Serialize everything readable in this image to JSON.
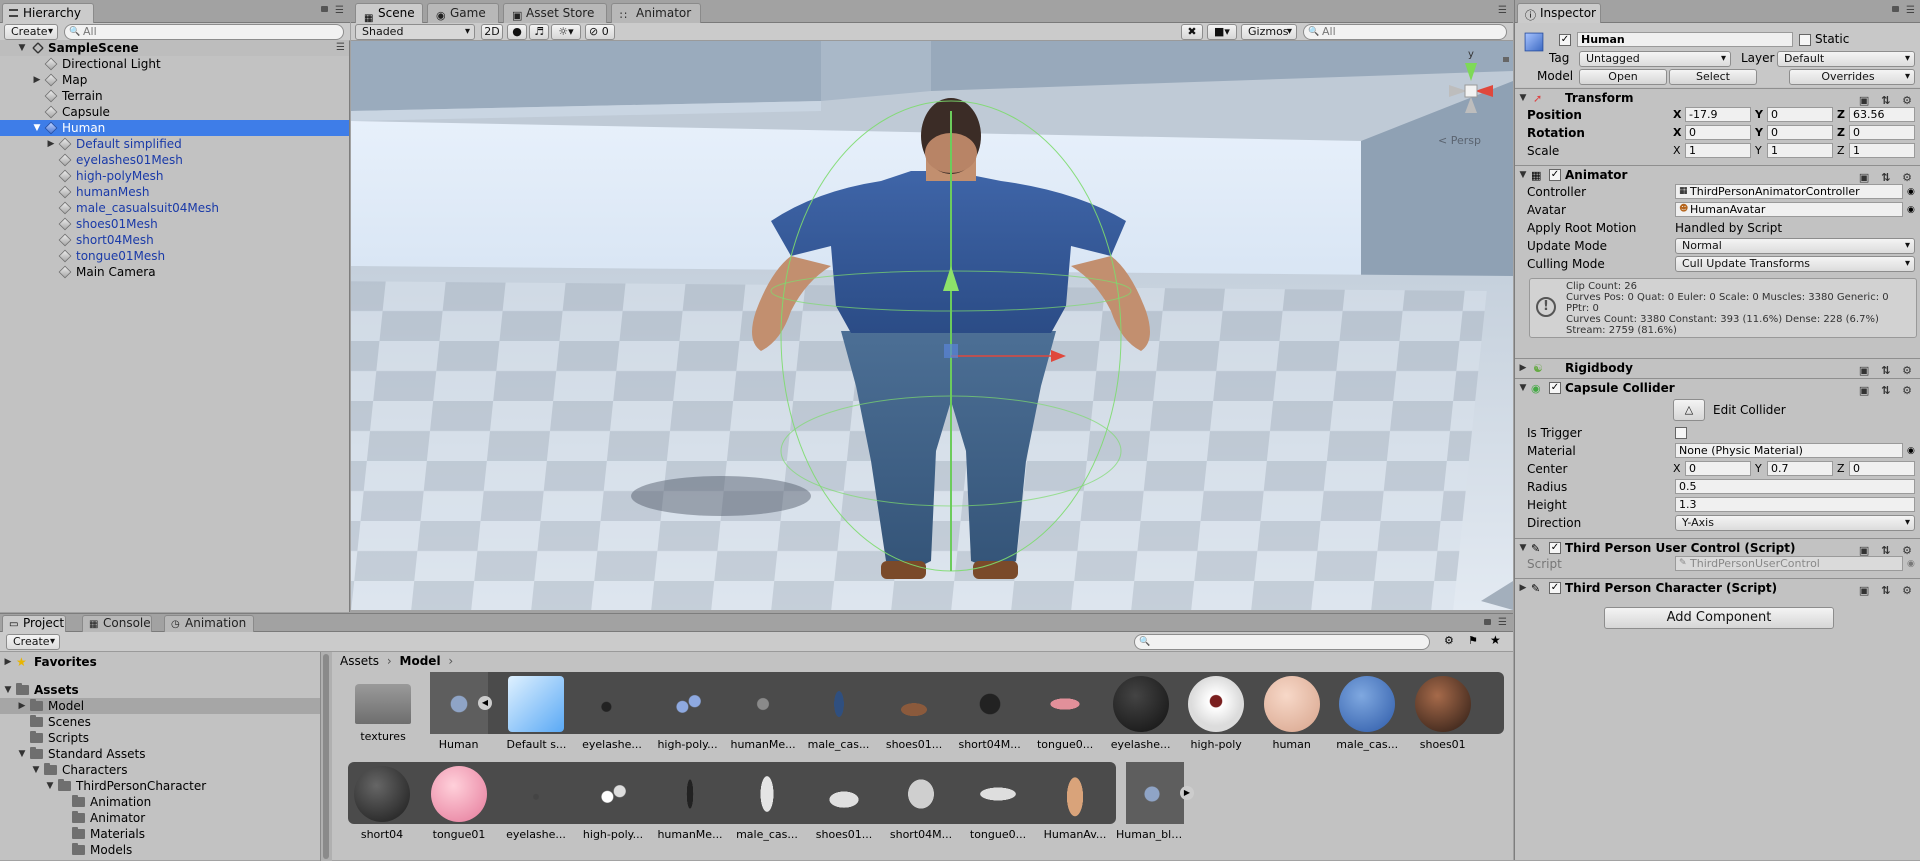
{
  "hierarchy": {
    "tab": "Hierarchy",
    "create": "Create",
    "search_placeholder": "All",
    "scene": "SampleScene",
    "items": [
      {
        "label": "Directional Light"
      },
      {
        "label": "Map"
      },
      {
        "label": "Terrain"
      },
      {
        "label": "Capsule"
      },
      {
        "label": "Human"
      },
      {
        "label": "Default simplified"
      },
      {
        "label": "eyelashes01Mesh"
      },
      {
        "label": "high-polyMesh"
      },
      {
        "label": "humanMesh"
      },
      {
        "label": "male_casualsuit04Mesh"
      },
      {
        "label": "shoes01Mesh"
      },
      {
        "label": "short04Mesh"
      },
      {
        "label": "tongue01Mesh"
      },
      {
        "label": "Main Camera"
      }
    ]
  },
  "scene_view": {
    "tabs": [
      "Scene",
      "Game",
      "Asset Store",
      "Animator"
    ],
    "shading": "Shaded",
    "mode_2d": "2D",
    "fx_count": "0",
    "gizmos": "Gizmos",
    "search_placeholder": "All",
    "persp": "< Persp",
    "gizmo_axes": {
      "y": "y"
    }
  },
  "inspector": {
    "tab": "Inspector",
    "object_name": "Human",
    "static_label": "Static",
    "tag_label": "Tag",
    "tag_value": "Untagged",
    "layer_label": "Layer",
    "layer_value": "Default",
    "model_label": "Model",
    "model_open": "Open",
    "model_select": "Select",
    "model_overrides": "Overrides",
    "transform": {
      "title": "Transform",
      "position_label": "Position",
      "rotation_label": "Rotation",
      "scale_label": "Scale",
      "position": {
        "x": "-17.9",
        "y": "0",
        "z": "63.56"
      },
      "rotation": {
        "x": "0",
        "y": "0",
        "z": "0"
      },
      "scale": {
        "x": "1",
        "y": "1",
        "z": "1"
      }
    },
    "animator": {
      "title": "Animator",
      "controller_label": "Controller",
      "controller_value": "ThirdPersonAnimatorController",
      "avatar_label": "Avatar",
      "avatar_value": "HumanAvatar",
      "root_motion_label": "Apply Root Motion",
      "root_motion_value": "Handled by Script",
      "update_mode_label": "Update Mode",
      "update_mode_value": "Normal",
      "culling_label": "Culling Mode",
      "culling_value": "Cull Update Transforms",
      "info_lines": [
        "Clip Count: 26",
        "Curves Pos: 0 Quat: 0 Euler: 0 Scale: 0 Muscles: 3380 Generic: 0",
        "PPtr: 0",
        "Curves Count: 3380 Constant: 393 (11.6%) Dense: 228 (6.7%)",
        "Stream: 2759 (81.6%)"
      ]
    },
    "rigidbody": {
      "title": "Rigidbody"
    },
    "capsule": {
      "title": "Capsule Collider",
      "edit_collider": "Edit Collider",
      "trigger_label": "Is Trigger",
      "material_label": "Material",
      "material_value": "None (Physic Material)",
      "center_label": "Center",
      "center": {
        "x": "0",
        "y": "0.7",
        "z": "0"
      },
      "radius_label": "Radius",
      "radius_value": "0.5",
      "height_label": "Height",
      "height_value": "1.3",
      "direction_label": "Direction",
      "direction_value": "Y-Axis"
    },
    "tpuc": {
      "title": "Third Person User Control (Script)",
      "script_label": "Script",
      "script_value": "ThirdPersonUserControl"
    },
    "tpc": {
      "title": "Third Person Character (Script)"
    },
    "add_component": "Add Component",
    "xyz": {
      "x": "X",
      "y": "Y",
      "z": "Z"
    }
  },
  "project": {
    "tabs": [
      "Project",
      "Console",
      "Animation"
    ],
    "create": "Create",
    "favorites": "Favorites",
    "tree": [
      {
        "label": "Assets"
      },
      {
        "label": "Model"
      },
      {
        "label": "Scenes"
      },
      {
        "label": "Scripts"
      },
      {
        "label": "Standard Assets"
      },
      {
        "label": "Characters"
      },
      {
        "label": "ThirdPersonCharacter"
      },
      {
        "label": "Animation"
      },
      {
        "label": "Animator"
      },
      {
        "label": "Materials"
      },
      {
        "label": "Models"
      }
    ],
    "breadcrumb": [
      "Assets",
      "Model"
    ],
    "assets_row1": [
      "textures",
      "Human",
      "Default s...",
      "eyelashe...",
      "high-poly...",
      "humanMe...",
      "male_cas...",
      "shoes01...",
      "short04M...",
      "tongue0...",
      "eyelashe...",
      "high-poly",
      "human",
      "male_cas...",
      "shoes01"
    ],
    "assets_row2": [
      "short04",
      "tongue01",
      "eyelashe...",
      "high-poly...",
      "humanMe...",
      "male_cas...",
      "shoes01...",
      "short04M...",
      "tongue0...",
      "HumanAv...",
      "Human_ble..."
    ]
  },
  "colors": {
    "selection": "#3e7de8",
    "panel": "#c2c2c2",
    "prefab_text": "#1a3aa8"
  }
}
